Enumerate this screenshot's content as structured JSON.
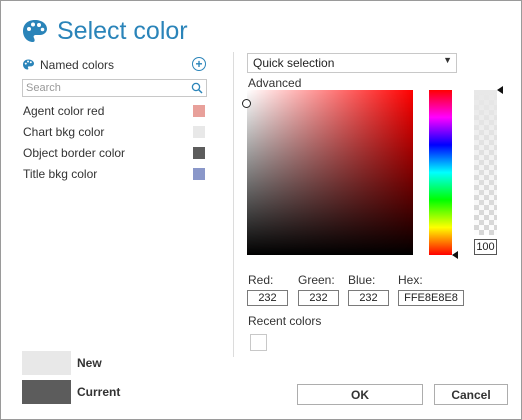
{
  "dialog": {
    "title": "Select color"
  },
  "named_colors": {
    "header": "Named colors",
    "add_symbol": "+",
    "search_placeholder": "Search",
    "items": [
      {
        "label": "Agent color red",
        "color": "#e8a09a"
      },
      {
        "label": "Chart bkg color",
        "color": "#e8e8e8"
      },
      {
        "label": "Object border color",
        "color": "#5c5c5c"
      },
      {
        "label": "Title bkg color",
        "color": "#8a97c9"
      }
    ]
  },
  "preview": {
    "new_label": "New",
    "new_color": "#e8e8e8",
    "current_label": "Current",
    "current_color": "#5c5c5c"
  },
  "picker": {
    "mode": "Quick selection",
    "advanced_label": "Advanced",
    "alpha": "100",
    "red_label": "Red:",
    "red": "232",
    "green_label": "Green:",
    "green": "232",
    "blue_label": "Blue:",
    "blue": "232",
    "hex_label": "Hex:",
    "hex": "FFE8E8E8",
    "recent_label": "Recent colors"
  },
  "buttons": {
    "ok": "OK",
    "cancel": "Cancel"
  },
  "colors": {
    "accent": "#2a84b9"
  }
}
